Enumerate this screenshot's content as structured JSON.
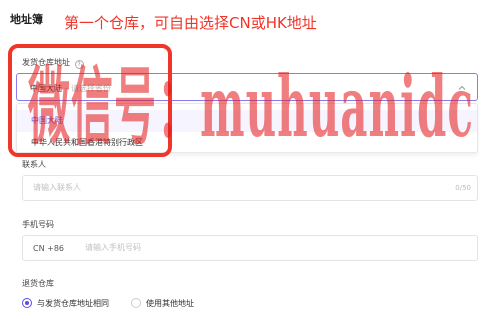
{
  "header": {
    "title": "地址簿",
    "annotation": "第一个仓库，可自由选择CN或HK地址"
  },
  "ship_warehouse": {
    "label": "发货仓库地址",
    "help_icon": "question-circle-icon",
    "selected_region": "中国大陆",
    "separator": "-",
    "placeholder": "请选择省份",
    "options": [
      "中国大陆",
      "中华人民共和国香港特别行政区"
    ]
  },
  "contact": {
    "label": "联系人",
    "placeholder": "请输入联系人",
    "counter": "0/50"
  },
  "phone": {
    "label": "手机号码",
    "prefix": "CN +86",
    "placeholder": "请输入手机号码"
  },
  "return_warehouse": {
    "label": "退货仓库",
    "options": [
      {
        "label": "与发货仓库地址相同",
        "checked": true
      },
      {
        "label": "使用其他地址",
        "checked": false
      }
    ]
  },
  "watermark": {
    "text": "微信号：muhuanidc"
  },
  "colors": {
    "annotation_red": "#f0352a",
    "accent_purple": "#5a4ee0",
    "watermark_red": "#e61414"
  }
}
